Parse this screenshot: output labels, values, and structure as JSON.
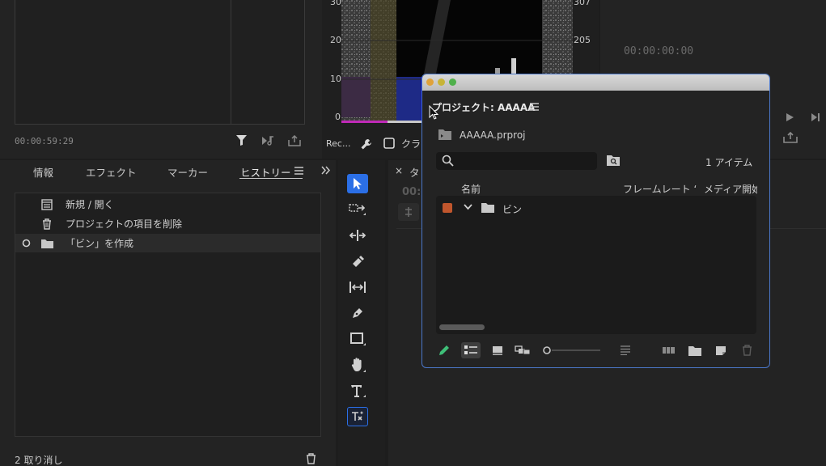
{
  "source_monitor": {
    "timecode": "00:00:59:29"
  },
  "scope": {
    "left_scale": [
      "30",
      "20",
      "10",
      "0"
    ],
    "right_scale": [
      "307",
      "205"
    ],
    "footer_label": "Rec...",
    "footer_label2": "クラ"
  },
  "program_monitor": {
    "timecode": "00:00:00:00"
  },
  "history_panel": {
    "tabs": [
      "情報",
      "エフェクト",
      "マーカー",
      "ヒストリー"
    ],
    "active_tab": "ヒストリー",
    "items": [
      {
        "label": "新規 / 開く",
        "icon": "new-open-icon"
      },
      {
        "label": "プロジェクトの項目を削除",
        "icon": "trash-icon"
      },
      {
        "label": "「ビン」を作成",
        "icon": "folder-icon",
        "selected": true
      }
    ],
    "footer": "2 取り消し"
  },
  "tools": [
    "selection-tool",
    "track-select-tool",
    "ripple-edit-tool",
    "razor-tool",
    "slip-tool",
    "pen-tool",
    "rectangle-tool",
    "hand-tool",
    "type-tool",
    "generative-extend-tool"
  ],
  "timeline": {
    "tab_prefix": "タ",
    "timecode_partial": "00:"
  },
  "project_window": {
    "title": "プロジェクト: AAAAA",
    "file": "AAAAA.prproj",
    "search_placeholder": "",
    "item_count": "1 アイテム",
    "columns": [
      "名前",
      "フレームレート",
      "メディア開始"
    ],
    "columns_display": [
      "名前",
      "フレームレート ‘",
      "メディア開始"
    ],
    "items": [
      {
        "name": "ビン",
        "label_color": "#c0562d",
        "type": "bin"
      }
    ]
  },
  "colors": {
    "accent_blue": "#2b6fe6",
    "project_border": "#4b77c9",
    "bin_label": "#c0562d",
    "pencil_green": "#3fbf78"
  }
}
